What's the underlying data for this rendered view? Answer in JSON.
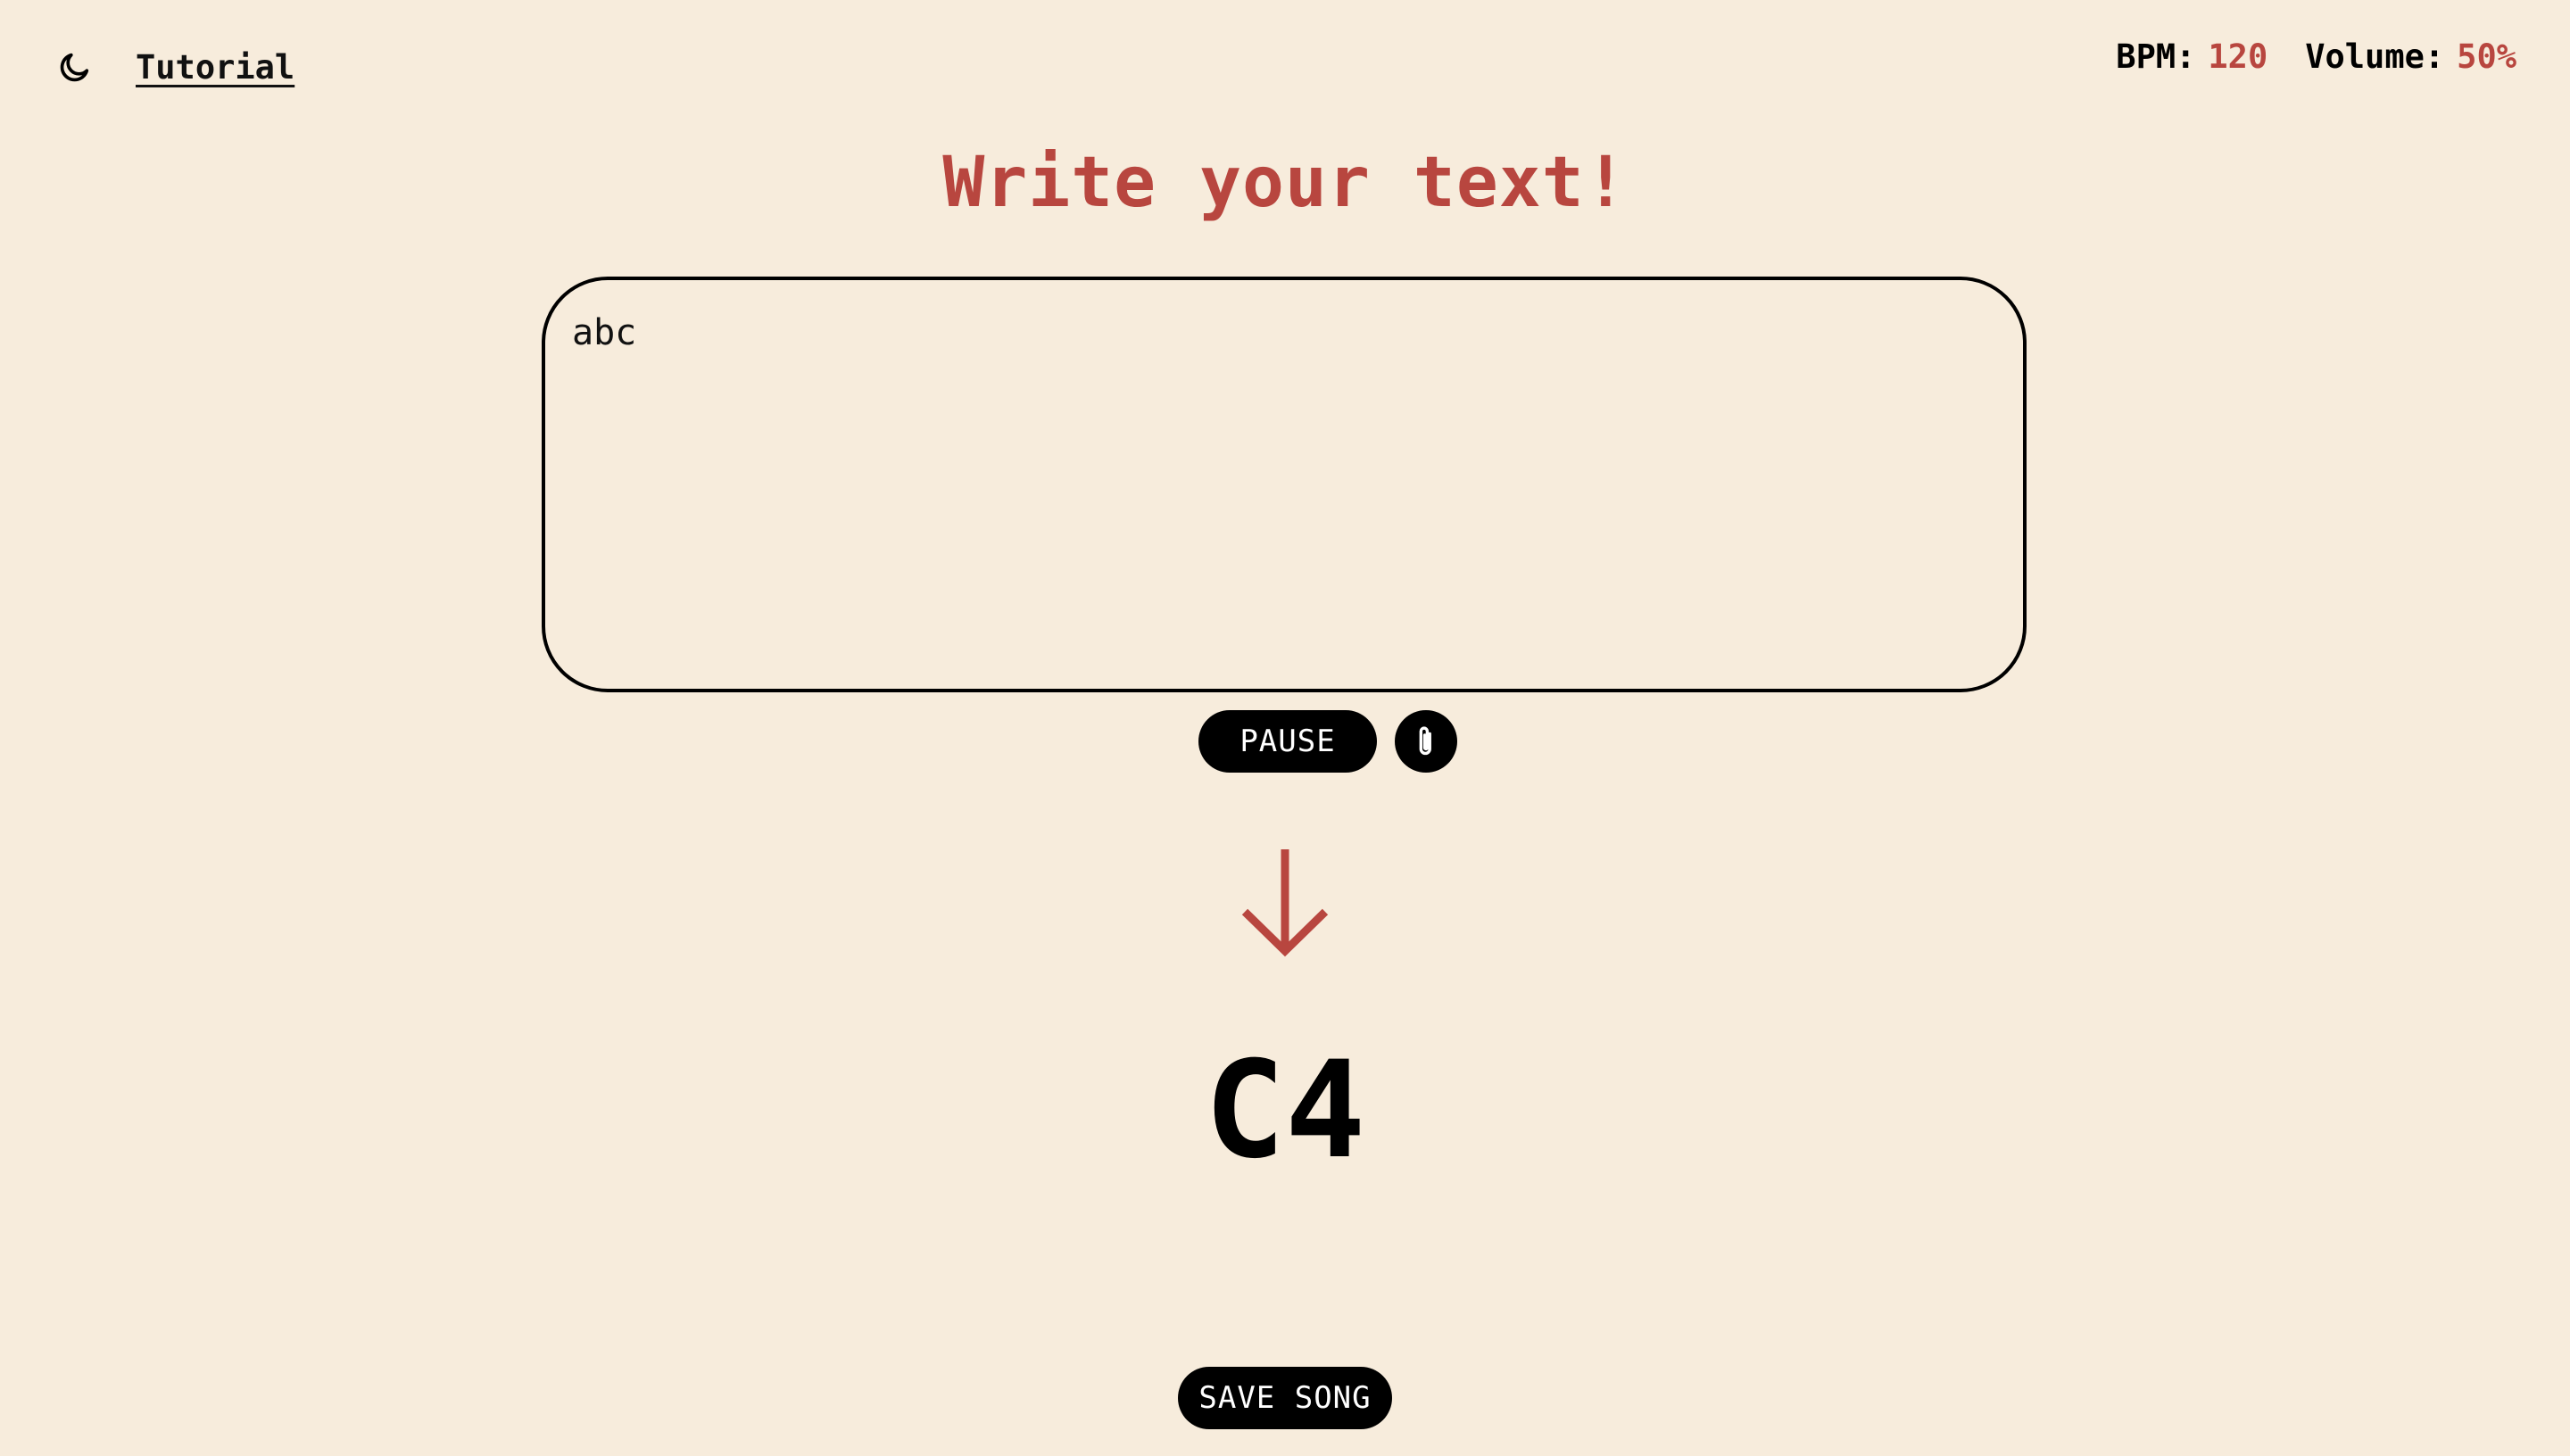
{
  "header": {
    "theme_toggle_icon": "moon-icon",
    "tutorial_label": "Tutorial",
    "bpm_label": "BPM:",
    "bpm_value": "120",
    "volume_label": "Volume:",
    "volume_value": "50%"
  },
  "main": {
    "headline": "Write your text!",
    "editor_value": "abc",
    "pause_label": "PAUSE",
    "attach_icon": "paperclip-icon",
    "arrow_icon": "arrow-down-icon",
    "current_note": "C4",
    "save_label": "SAVE SONG"
  },
  "colors": {
    "background": "#f7ecdc",
    "accent": "#b8463f",
    "text": "#000000"
  }
}
